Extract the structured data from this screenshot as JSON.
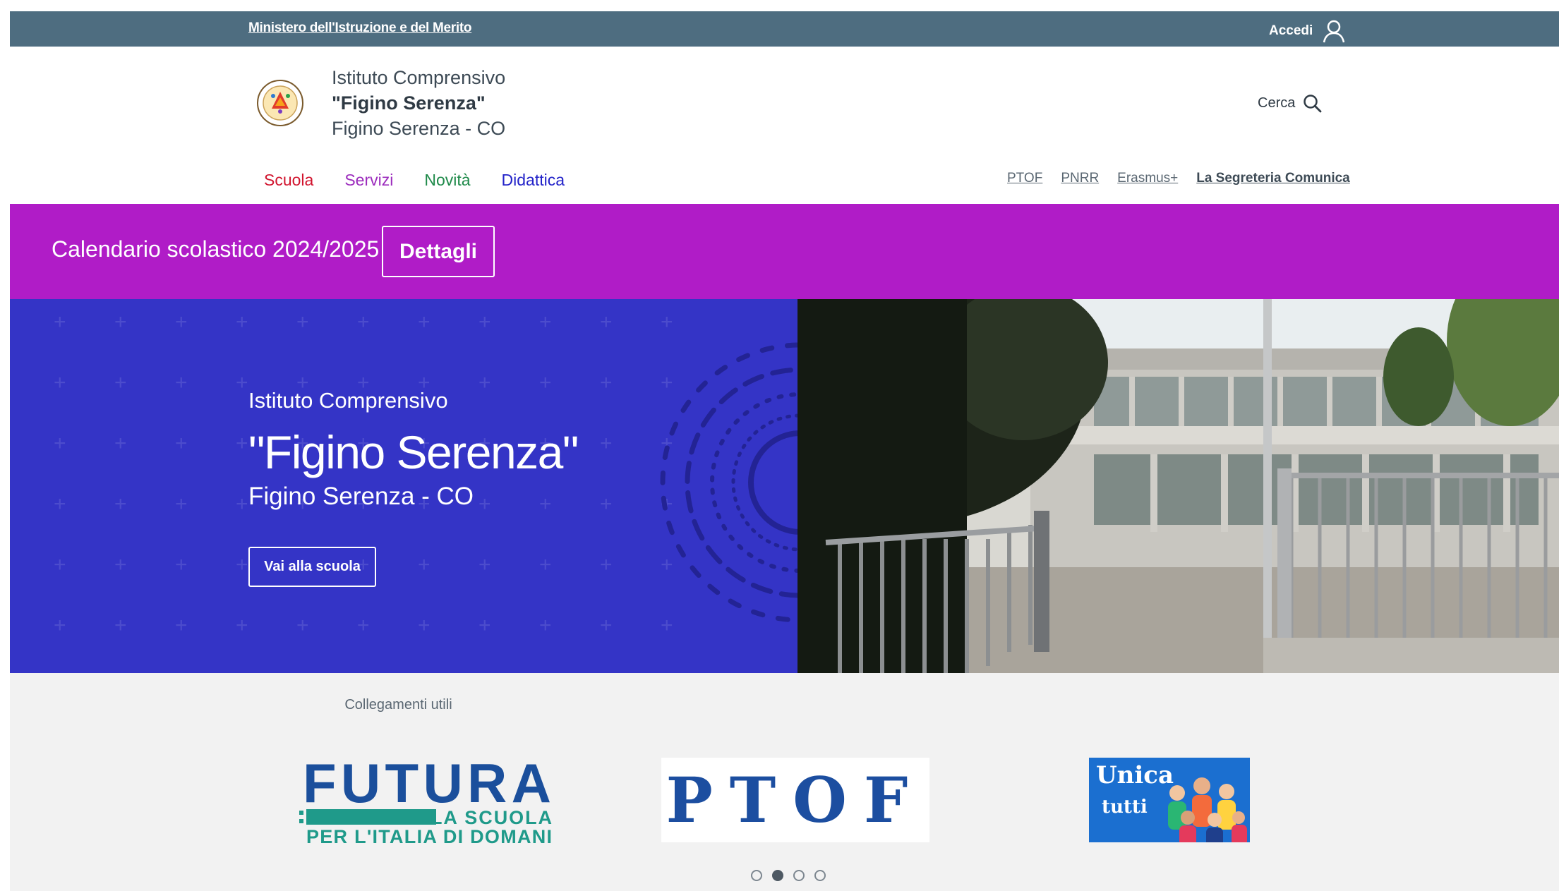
{
  "topbar": {
    "ministry_link": "Ministero dell'Istruzione e del Merito",
    "login_label": "Accedi"
  },
  "header": {
    "school_line1": "Istituto Comprensivo",
    "school_line2": "\"Figino Serenza\"",
    "school_line3": "Figino Serenza - CO",
    "search_label": "Cerca"
  },
  "main_nav": [
    {
      "label": "Scuola",
      "color": "#d1142e"
    },
    {
      "label": "Servizi",
      "color": "#9c2cbd"
    },
    {
      "label": "Novità",
      "color": "#1f8a4a"
    },
    {
      "label": "Didattica",
      "color": "#2323c9"
    }
  ],
  "secondary_nav": [
    "PTOF",
    "PNRR",
    "Erasmus+",
    "La Segreteria Comunica"
  ],
  "banner": {
    "label": "Calendario scolastico 2024/2025",
    "button_label": "Dettagli",
    "color": "#b01cc7"
  },
  "hero": {
    "line1": "Istituto Comprensivo",
    "line2": "\"Figino Serenza\"",
    "line3": "Figino Serenza - CO",
    "button_label": "Vai alla scuola",
    "background": "#3434c6"
  },
  "links": {
    "title": "Collegamenti utili",
    "futura": {
      "line1": "FUTURA",
      "line2": "LA SCUOLA",
      "line3": "PER L'ITALIA DI DOMANI"
    },
    "ptof": "PTOF",
    "unica": {
      "line1": "Unica",
      "line2": "tutti"
    },
    "carousel_pages": 4,
    "carousel_active": 2
  }
}
